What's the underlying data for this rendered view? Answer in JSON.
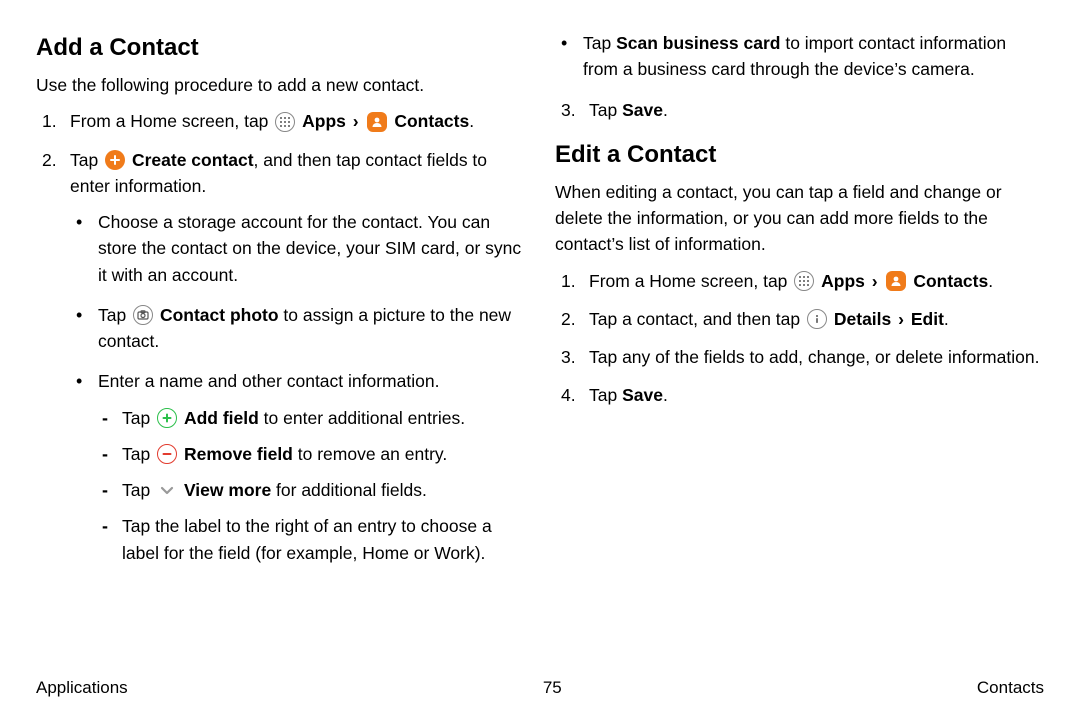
{
  "left": {
    "heading": "Add a Contact",
    "intro": "Use the following procedure to add a new contact.",
    "step1": {
      "num": "1.",
      "t1": "From a Home screen, tap ",
      "apps": "Apps",
      "chev": "›",
      "contacts": "Contacts",
      "end": "."
    },
    "step2": {
      "num": "2.",
      "t1": "Tap ",
      "create": "Create contact",
      "t2": ", and then tap contact fields to enter information.",
      "b1": "Choose a storage account for the contact. You can store the contact on the device, your SIM card, or sync it with an account.",
      "b2_t1": "Tap ",
      "b2_cp": "Contact photo",
      "b2_t2": " to assign a picture to the new contact.",
      "b3": "Enter a name and other contact information.",
      "d1_t1": "Tap ",
      "d1_af": "Add field",
      "d1_t2": " to enter additional entries.",
      "d2_t1": "Tap ",
      "d2_rf": "Remove field",
      "d2_t2": " to remove an entry.",
      "d3_t1": "Tap ",
      "d3_vm": "View more",
      "d3_t2": " for additional fields.",
      "d4": "Tap the label to the right of an entry to choose a label for the field (for example, Home or Work)."
    }
  },
  "right": {
    "cont_b4_t1": "Tap ",
    "cont_b4_sbc": "Scan business card",
    "cont_b4_t2": " to import contact information from a business card through the device’s camera.",
    "step3": {
      "num": "3.",
      "t1": "Tap ",
      "save": "Save",
      "end": "."
    },
    "heading": "Edit a Contact",
    "intro": "When editing a contact, you can tap a field and change or delete the information, or you can add more fields to the contact’s list of information.",
    "e1": {
      "num": "1.",
      "t1": "From a Home screen, tap ",
      "apps": "Apps",
      "chev": "›",
      "contacts": "Contacts",
      "end": "."
    },
    "e2": {
      "num": "2.",
      "t1": "Tap a contact, and then tap ",
      "details": "Details",
      "chev": "›",
      "edit": "Edit",
      "end": "."
    },
    "e3": {
      "num": "3.",
      "t": "Tap any of the fields to add, change, or delete information."
    },
    "e4": {
      "num": "4.",
      "t1": "Tap ",
      "save": "Save",
      "end": "."
    }
  },
  "footer": {
    "left": "Applications",
    "center": "75",
    "right": "Contacts"
  }
}
